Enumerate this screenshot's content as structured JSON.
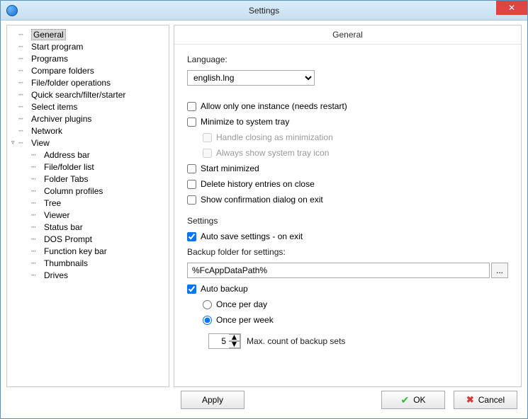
{
  "window": {
    "title": "Settings",
    "close_glyph": "✕"
  },
  "tree": {
    "items": [
      {
        "label": "General",
        "level": 0,
        "selected": true,
        "expander": ""
      },
      {
        "label": "Start program",
        "level": 0
      },
      {
        "label": "Programs",
        "level": 0
      },
      {
        "label": "Compare folders",
        "level": 0
      },
      {
        "label": "File/folder operations",
        "level": 0
      },
      {
        "label": "Quick search/filter/starter",
        "level": 0
      },
      {
        "label": "Select items",
        "level": 0
      },
      {
        "label": "Archiver plugins",
        "level": 0
      },
      {
        "label": "Network",
        "level": 0
      },
      {
        "label": "View",
        "level": 0,
        "expander": "▿"
      },
      {
        "label": "Address bar",
        "level": 1
      },
      {
        "label": "File/folder list",
        "level": 1
      },
      {
        "label": "Folder Tabs",
        "level": 1
      },
      {
        "label": "Column profiles",
        "level": 1
      },
      {
        "label": "Tree",
        "level": 1
      },
      {
        "label": "Viewer",
        "level": 1
      },
      {
        "label": "Status bar",
        "level": 1
      },
      {
        "label": "DOS Prompt",
        "level": 1
      },
      {
        "label": "Function key bar",
        "level": 1
      },
      {
        "label": "Thumbnails",
        "level": 1
      },
      {
        "label": "Drives",
        "level": 1
      }
    ]
  },
  "panel": {
    "title": "General",
    "language_label": "Language:",
    "language_value": "english.lng",
    "checkboxes": {
      "allow_one_instance": {
        "label": "Allow only one instance (needs restart)",
        "checked": false
      },
      "minimize_tray": {
        "label": "Minimize to system tray",
        "checked": false
      },
      "handle_close_min": {
        "label": "Handle closing as minimization",
        "checked": false,
        "disabled": true
      },
      "always_tray_icon": {
        "label": "Always show system tray icon",
        "checked": false,
        "disabled": true
      },
      "start_minimized": {
        "label": "Start minimized",
        "checked": false
      },
      "delete_history": {
        "label": "Delete history entries on close",
        "checked": false
      },
      "confirm_exit": {
        "label": "Show confirmation dialog on exit",
        "checked": false
      }
    },
    "settings_section_label": "Settings",
    "auto_save": {
      "label": "Auto save settings - on exit",
      "checked": true
    },
    "backup_folder_label": "Backup folder for settings:",
    "backup_folder_value": "%FcAppDataPath%",
    "browse_glyph": "...",
    "auto_backup": {
      "label": "Auto backup",
      "checked": true
    },
    "backup_freq": {
      "day": {
        "label": "Once per day",
        "checked": false
      },
      "week": {
        "label": "Once per week",
        "checked": true
      }
    },
    "max_backup": {
      "value": "5",
      "label": "Max. count of backup sets",
      "up": "▲",
      "down": "▼"
    }
  },
  "footer": {
    "apply": "Apply",
    "ok": "OK",
    "cancel": "Cancel",
    "ok_glyph": "✔",
    "cancel_glyph": "✖"
  }
}
